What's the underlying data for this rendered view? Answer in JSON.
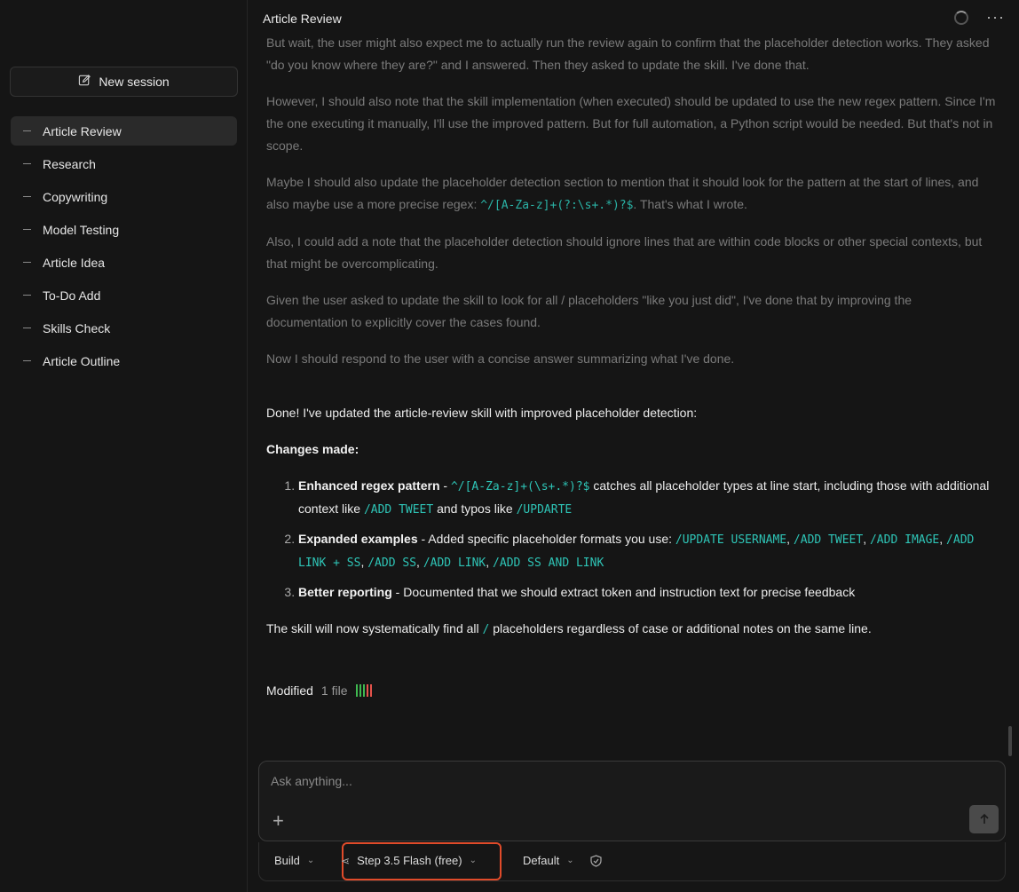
{
  "sidebar": {
    "new_session_label": "New session",
    "sessions": [
      {
        "label": "Article Review",
        "active": true
      },
      {
        "label": "Research"
      },
      {
        "label": "Copywriting"
      },
      {
        "label": "Model Testing"
      },
      {
        "label": "Article Idea"
      },
      {
        "label": "To-Do Add"
      },
      {
        "label": "Skills Check"
      },
      {
        "label": "Article Outline"
      }
    ]
  },
  "header": {
    "title": "Article Review",
    "more_icon": "ellipsis-icon"
  },
  "thoughts": {
    "p1": "But wait, the user might also expect me to actually run the review again to confirm that the placeholder detection works. They asked \"do you know where they are?\" and I answered. Then they asked to update the skill. I've done that.",
    "p2": "However, I should also note that the skill implementation (when executed) should be updated to use the new regex pattern. Since I'm the one executing it manually, I'll use the improved pattern. But for full automation, a Python script would be needed. But that's not in scope.",
    "p3_before": "Maybe I should also update the placeholder detection section to mention that it should look for the pattern at the start of lines, and also maybe use a more precise regex: ",
    "p3_code": "^/[A-Za-z]+(?:\\s+.*)?$",
    "p3_after": ". That's what I wrote.",
    "p4": "Also, I could add a note that the placeholder detection should ignore lines that are within code blocks or other special contexts, but that might be overcomplicating.",
    "p5": "Given the user asked to update the skill to look for all / placeholders \"like you just did\", I've done that by improving the documentation to explicitly cover the cases found.",
    "p6": "Now I should respond to the user with a concise answer summarizing what I've done."
  },
  "answer": {
    "intro": "Done! I've updated the article-review skill with improved placeholder detection:",
    "changes_heading": "Changes made:",
    "item1": {
      "title": "Enhanced regex pattern",
      "sep": " - ",
      "code1": "^/[A-Za-z]+(\\s+.*)?$",
      "text1": " catches all placeholder types at line start, including those with additional context like ",
      "code2": "/ADD TWEET",
      "text2": " and typos like ",
      "code3": "/UPDARTE"
    },
    "item2": {
      "title": "Expanded examples",
      "text": " - Added specific placeholder formats you use: ",
      "codes": [
        "/UPDATE USERNAME",
        "/ADD TWEET",
        "/ADD IMAGE",
        "/ADD LINK + SS",
        "/ADD SS",
        "/ADD LINK",
        "/ADD SS AND LINK"
      ]
    },
    "item3": {
      "title": "Better reporting",
      "text": " - Documented that we should extract token and instruction text for precise feedback"
    },
    "closing_before": "The skill will now systematically find all ",
    "closing_code": "/",
    "closing_after": " placeholders regardless of case or additional notes on the same line."
  },
  "modified": {
    "label": "Modified",
    "count": "1 file",
    "colors": {
      "added": "#3fb950",
      "removed": "#e5534b"
    }
  },
  "composer": {
    "placeholder": "Ask anything...",
    "add_icon": "plus-icon",
    "send_icon": "arrow-up-icon"
  },
  "toolbar": {
    "mode": "Build",
    "model": "Step 3.5 Flash (free)",
    "variant": "Default",
    "shield_icon": "shield-check-icon"
  },
  "colors": {
    "accent_code": "#2ec4b6",
    "highlight": "#e04b2a"
  }
}
